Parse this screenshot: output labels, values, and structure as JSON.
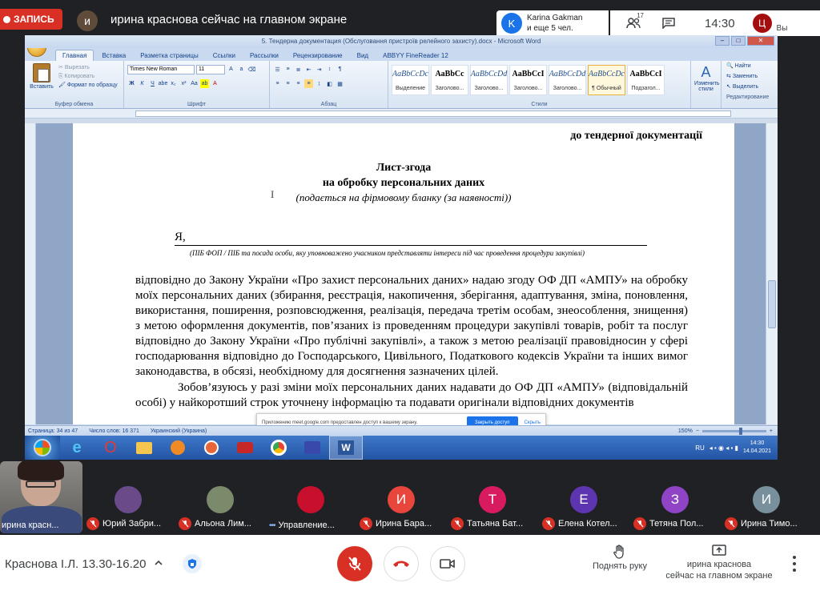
{
  "meet_top": {
    "recording_label": "ЗАПИСЬ",
    "presenter_initial": "и",
    "presenter_status": "ирина краснова сейчас на главном экране",
    "notification": {
      "initial": "K",
      "line1": "Karina Gakman",
      "line2": "и еще 5 чел."
    },
    "participants_count": "17",
    "clock": "14:30",
    "self_initial": "Ц",
    "self_label": "Вы"
  },
  "word": {
    "title": "5. Тендерна документация (Обслуговання пристроїв релейного захисту).docx - Microsoft Word",
    "tabs": [
      "Главная",
      "Вставка",
      "Разметка страницы",
      "Ссылки",
      "Рассылки",
      "Рецензирование",
      "Вид",
      "ABBYY FineReader 12"
    ],
    "clipboard": {
      "paste": "Вставить",
      "cut": "Вырезать",
      "copy": "Копировать",
      "format": "Формат по образцу",
      "group": "Буфер обмена"
    },
    "font": {
      "name": "Times New Roman",
      "size": "11",
      "group": "Шрифт"
    },
    "paragraph_group": "Абзац",
    "styles": [
      {
        "preview": "AaBbCcDc",
        "name": "Выделение",
        "bold": false
      },
      {
        "preview": "AaBbCc",
        "name": "Заголово...",
        "bold": true
      },
      {
        "preview": "AaBbCcDd",
        "name": "Заголово...",
        "bold": false
      },
      {
        "preview": "AaBbCcI",
        "name": "Заголово...",
        "bold": true
      },
      {
        "preview": "AaBbCcDd",
        "name": "Заголово...",
        "bold": false
      },
      {
        "preview": "AaBbCcDc",
        "name": "¶ Обычный",
        "bold": false
      },
      {
        "preview": "AaBbCcI",
        "name": "Подзагол...",
        "bold": true
      }
    ],
    "styles_group": "Стили",
    "change_styles": "Изменить стили",
    "edit": {
      "find": "Найти",
      "replace": "Заменить",
      "select": "Выделить",
      "group": "Редактирование"
    },
    "status": {
      "page": "Страница: 34 из 47",
      "words": "Число слов: 16 371",
      "language": "Украинский (Украина)",
      "zoom": "150%"
    },
    "taskbar": {
      "lang": "RU",
      "time": "14:30",
      "date": "14.04.2021"
    }
  },
  "document": {
    "header_right": "до тендерної документації",
    "title_line1": "Лист-згода",
    "title_line2": "на обробку персональних даних",
    "note": "(подається на фірмовому бланку (за наявності))",
    "ya": "Я,",
    "ya_note": "(ПІБ ФОП / ПІБ та посада особи, яку уповноважено учасником представляти інтереси під час проведення процедури закупівлі)",
    "para1": "відповідно до Закону України «Про захист персональних даних» надаю згоду ОФ ДП «АМПУ» на обробку моїх персональних даних (збирання, реєстрація, накопичення, зберігання, адаптування, зміна, поновлення, використання, поширення, розповсюдження, реалізація, передача третім особам, знеособлення, знищення) з метою оформлення документів, пов’язаних із проведенням процедури закупівлі товарів, робіт та послуг відповідно до Закону України «Про публічні закупівлі», а також з метою реалізації правовідносин у сфері господарювання відповідно до Господарського, Цивільного, Податкового кодексів України та інших вимог законодавства, в обсязі, необхідному для досягнення зазначених цілей.",
    "para2": "Зобов’язуюсь у разі зміни моїх персональних даних надавати до ОФ ДП «АМПУ» (відповідальній особі) у найкоротший строк уточнену інформацію та подавати оригінали відповідних документів"
  },
  "share_banner": {
    "text": "Приложению meet.google.com предоставлен доступ к вашему экрану.",
    "stop": "Закрыть доступ",
    "hide": "Скрыть"
  },
  "participants": [
    {
      "name": "ирина красн...",
      "initial": "",
      "color": "",
      "muted": false,
      "self": true
    },
    {
      "name": "Юрий Забри...",
      "initial": "",
      "color": "#6b4a8a",
      "muted": true
    },
    {
      "name": "Альона Лим...",
      "initial": "",
      "color": "#7a8a6a",
      "muted": true
    },
    {
      "name": "Управление...",
      "initial": "",
      "color": "#c8102e",
      "muted": false
    },
    {
      "name": "Ирина Бара...",
      "initial": "И",
      "color": "#e8453c",
      "muted": true
    },
    {
      "name": "Татьяна Бат...",
      "initial": "Т",
      "color": "#d81b60",
      "muted": true
    },
    {
      "name": "Елена Котел...",
      "initial": "Е",
      "color": "#5e35b1",
      "muted": true
    },
    {
      "name": "Тетяна Пол...",
      "initial": "З",
      "color": "#8e44c4",
      "muted": true
    },
    {
      "name": "Ирина Тимо...",
      "initial": "И",
      "color": "#78909c",
      "muted": true
    }
  ],
  "bottom": {
    "meeting_title": "Краснова І.Л. 13.30-16.20",
    "raise_hand": "Поднять руку",
    "presenting_line1": "ирина краснова",
    "presenting_line2": "сейчас на главном экране"
  },
  "colors": {
    "meet_dark": "#202124",
    "mic_off": "#d93025",
    "accent": "#1a73e8",
    "word_blue": "#15428b"
  }
}
